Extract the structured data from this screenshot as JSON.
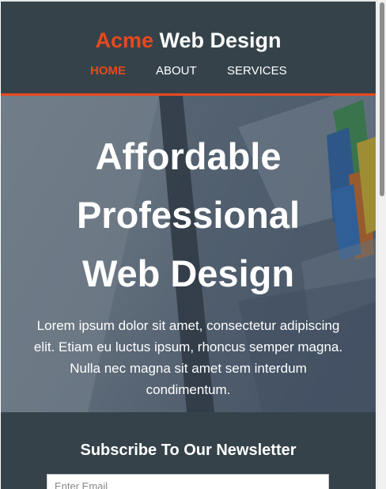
{
  "brand": {
    "highlight": "Acme",
    "rest": "Web Design"
  },
  "nav": {
    "items": [
      {
        "label": "Home",
        "active": true
      },
      {
        "label": "About",
        "active": false
      },
      {
        "label": "Services",
        "active": false
      }
    ]
  },
  "hero": {
    "title_lines": [
      "Affordable",
      "Professional",
      "Web Design"
    ],
    "text": "Lorem ipsum dolor sit amet, consectetur adipiscing elit. Etiam eu luctus ipsum, rhoncus semper magna. Nulla nec magna sit amet sem interdum condimentum."
  },
  "newsletter": {
    "title": "Subscribe To Our Newsletter",
    "placeholder": "Enter Email"
  },
  "colors": {
    "accent": "#e8491d",
    "dark": "#35424a",
    "text": "#ffffff"
  }
}
